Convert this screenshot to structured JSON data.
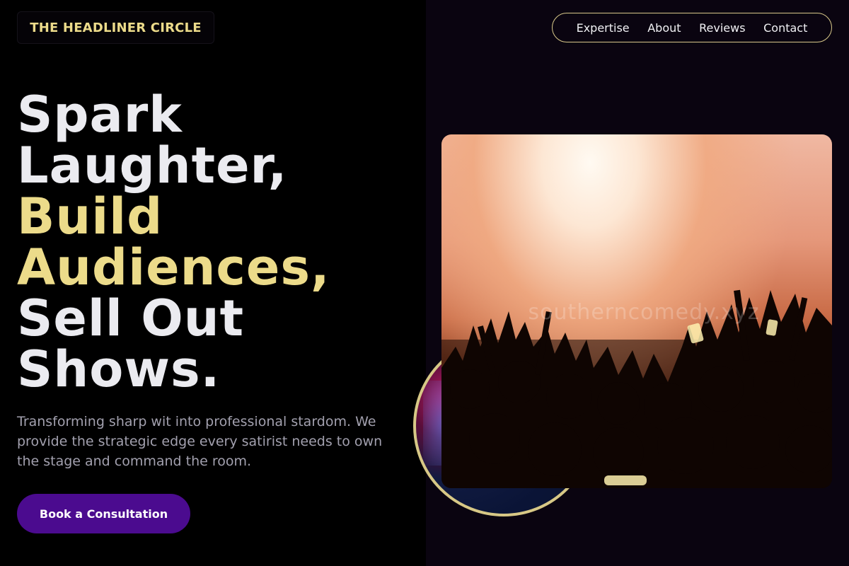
{
  "brand": {
    "logo_text": "THE HEADLINER CIRCLE"
  },
  "nav": {
    "items": [
      {
        "label": "Expertise"
      },
      {
        "label": "About"
      },
      {
        "label": "Reviews"
      },
      {
        "label": "Contact"
      }
    ]
  },
  "hero": {
    "headline_lines": [
      "Spark",
      "Laughter,",
      "Build",
      "Audiences,",
      "Sell Out",
      "Shows."
    ],
    "subtext": "Transforming sharp wit into professional stardom. We provide the strategic edge every satirist needs to own the stage and command the room.",
    "cta_label": "Book a Consultation"
  },
  "images": {
    "watermark_text": "southerncomedy.xyz"
  },
  "colors": {
    "accent_gold": "#ecdb8a",
    "cta_purple": "#4b0b8f",
    "left_background": "#000000",
    "right_background": "#0a0410",
    "headline_white": "#ebebf0",
    "subtext_gray": "#a2a0ae"
  }
}
